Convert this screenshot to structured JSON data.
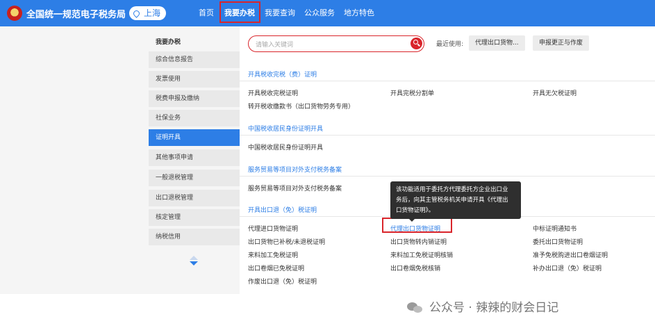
{
  "header": {
    "site_title": "全国统一规范电子税务局",
    "region": "上海",
    "nav": [
      "首页",
      "我要办税",
      "我要查询",
      "公众服务",
      "地方特色"
    ]
  },
  "sidebar": {
    "title": "我要办税",
    "items": [
      "综合信息报告",
      "发票使用",
      "税费申报及缴纳",
      "社保业务",
      "证明开具",
      "其他事项申请",
      "一般退税管理",
      "出口退税管理",
      "核定管理",
      "纳税信用"
    ],
    "active": "证明开具"
  },
  "search": {
    "placeholder": "请输入关键词"
  },
  "recent": {
    "label": "最近使用:",
    "items": [
      "代理出口货物...",
      "申报更正与作废"
    ]
  },
  "sections": [
    {
      "title": "开具税收完税（费）证明",
      "links": [
        "开具税收完税证明",
        "开具完税分割单",
        "开具无欠税证明",
        "转开税收缴款书（出口货物劳务专用）"
      ]
    },
    {
      "title": "中国税收居民身份证明开具",
      "links": [
        "中国税收居民身份证明开具"
      ]
    },
    {
      "title": "服务贸易等项目对外支付税务备案",
      "links": [
        "服务贸易等项目对外支付税务备案"
      ]
    },
    {
      "title": "开具出口退（免）税证明",
      "links": [
        "代理进口货物证明",
        "代理出口货物证明",
        "中标证明通知书",
        "出口货物已补税/未退税证明",
        "出口货物转内销证明",
        "委托出口货物证明",
        "来料加工免税证明",
        "来料加工免税证明核销",
        "准予免税购进出口卷烟证明",
        "出口卷烟已免税证明",
        "出口卷烟免税核销",
        "补办出口退（免）税证明",
        "作废出口退（免）税证明"
      ]
    }
  ],
  "tooltip": "该功能适用于委托方代理委托方企业出口业\n务后，向其主管税务机关申请开具《代理出\n口货物证明》。",
  "watermark": "公众号 · 辣辣的财会日记"
}
